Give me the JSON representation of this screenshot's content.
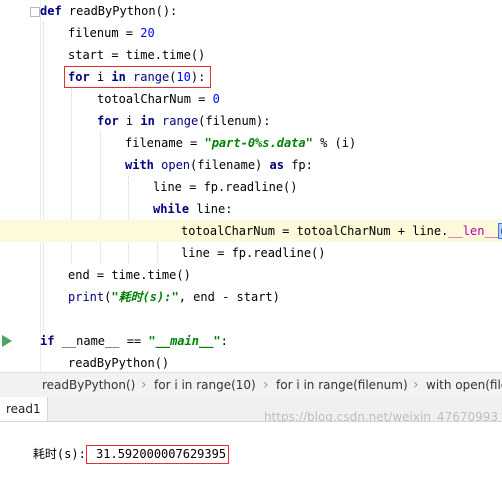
{
  "editor": {
    "lines": [
      [
        {
          "t": "def ",
          "c": "kw"
        },
        {
          "t": "readByPython():"
        }
      ],
      [
        {
          "t": "filenum = "
        },
        {
          "t": "20",
          "c": "num"
        }
      ],
      [
        {
          "t": "start = time.time()"
        }
      ],
      [
        {
          "t": "for ",
          "c": "kw"
        },
        {
          "t": "i "
        },
        {
          "t": "in ",
          "c": "kw"
        },
        {
          "t": "range",
          "c": "builtin"
        },
        {
          "t": "("
        },
        {
          "t": "10",
          "c": "num"
        },
        {
          "t": "):"
        }
      ],
      [
        {
          "t": "totoalCharNum = "
        },
        {
          "t": "0",
          "c": "num"
        }
      ],
      [
        {
          "t": "for ",
          "c": "kw"
        },
        {
          "t": "i "
        },
        {
          "t": "in ",
          "c": "kw"
        },
        {
          "t": "range",
          "c": "builtin"
        },
        {
          "t": "(filenum):"
        }
      ],
      [
        {
          "t": "filename = "
        },
        {
          "t": "\"part-0%s.data\"",
          "c": "str"
        },
        {
          "t": " % (i)"
        }
      ],
      [
        {
          "t": "with ",
          "c": "kw"
        },
        {
          "t": "open",
          "c": "builtin"
        },
        {
          "t": "(filename) "
        },
        {
          "t": "as ",
          "c": "kw"
        },
        {
          "t": "fp:"
        }
      ],
      [
        {
          "t": "line = fp.readline()"
        }
      ],
      [
        {
          "t": "while ",
          "c": "kw"
        },
        {
          "t": "line:"
        }
      ],
      [
        {
          "t": "totoalCharNum = totoalCharNum + line."
        },
        {
          "t": "__len__",
          "c": "magic"
        },
        {
          "t": "()",
          "c": "caret"
        }
      ],
      [
        {
          "t": "line = fp.readline()"
        }
      ],
      [
        {
          "t": "end = time.time()"
        }
      ],
      [
        {
          "t": "print",
          "c": "builtin"
        },
        {
          "t": "("
        },
        {
          "t": "\"耗时(s):\"",
          "c": "str"
        },
        {
          "t": ", end - start)"
        }
      ],
      [],
      [
        {
          "t": "if ",
          "c": "kw"
        },
        {
          "t": "__name__ == "
        },
        {
          "t": "\"__main__\"",
          "c": "str"
        },
        {
          "t": ":"
        }
      ],
      [
        {
          "t": "readByPython()"
        }
      ]
    ]
  },
  "breadcrumb": {
    "items": [
      "readByPython()",
      "for i in range(10)",
      "for i in range(filenum)",
      "with open(file"
    ]
  },
  "run_panel": {
    "tab_label": "read1",
    "output_label": "耗时(s):",
    "output_value": " 31.592000007629395"
  },
  "watermark": "https://blog.csdn.net/weixin_47670993"
}
